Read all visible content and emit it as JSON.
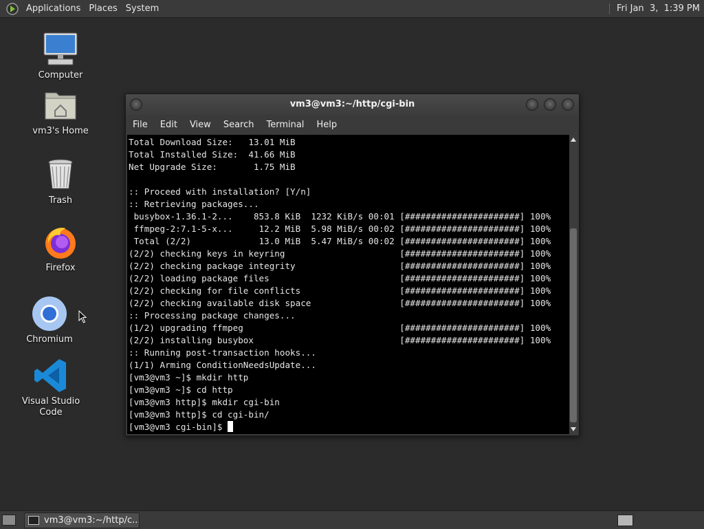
{
  "top_panel": {
    "menus": [
      "Applications",
      "Places",
      "System"
    ],
    "clock": "Fri Jan  3,  1:39 PM"
  },
  "desktop_icons": [
    {
      "label": "Computer",
      "icon": "computer-icon"
    },
    {
      "label": "vm3's Home",
      "icon": "home-folder-icon"
    },
    {
      "label": "Trash",
      "icon": "trash-icon"
    },
    {
      "label": "Firefox",
      "icon": "firefox-icon"
    },
    {
      "label": "Chromium",
      "icon": "chromium-icon"
    },
    {
      "label": "Visual Studio Code",
      "icon": "vscode-icon"
    }
  ],
  "terminal": {
    "title": "vm3@vm3:~/http/cgi-bin",
    "menu": [
      "File",
      "Edit",
      "View",
      "Search",
      "Terminal",
      "Help"
    ],
    "lines": [
      "Total Download Size:   13.01 MiB",
      "Total Installed Size:  41.66 MiB",
      "Net Upgrade Size:       1.75 MiB",
      "",
      ":: Proceed with installation? [Y/n]",
      ":: Retrieving packages...",
      " busybox-1.36.1-2...    853.8 KiB  1232 KiB/s 00:01 [######################] 100%",
      " ffmpeg-2:7.1-5-x...     12.2 MiB  5.98 MiB/s 00:02 [######################] 100%",
      " Total (2/2)             13.0 MiB  5.47 MiB/s 00:02 [######################] 100%",
      "(2/2) checking keys in keyring                      [######################] 100%",
      "(2/2) checking package integrity                    [######################] 100%",
      "(2/2) loading package files                         [######################] 100%",
      "(2/2) checking for file conflicts                   [######################] 100%",
      "(2/2) checking available disk space                 [######################] 100%",
      ":: Processing package changes...",
      "(1/2) upgrading ffmpeg                              [######################] 100%",
      "(2/2) installing busybox                            [######################] 100%",
      ":: Running post-transaction hooks...",
      "(1/1) Arming ConditionNeedsUpdate...",
      "[vm3@vm3 ~]$ mkdir http",
      "[vm3@vm3 ~]$ cd http",
      "[vm3@vm3 http]$ mkdir cgi-bin",
      "[vm3@vm3 http]$ cd cgi-bin/"
    ],
    "prompt": "[vm3@vm3 cgi-bin]$ "
  },
  "taskbar": {
    "task_label": "vm3@vm3:~/http/c..."
  }
}
